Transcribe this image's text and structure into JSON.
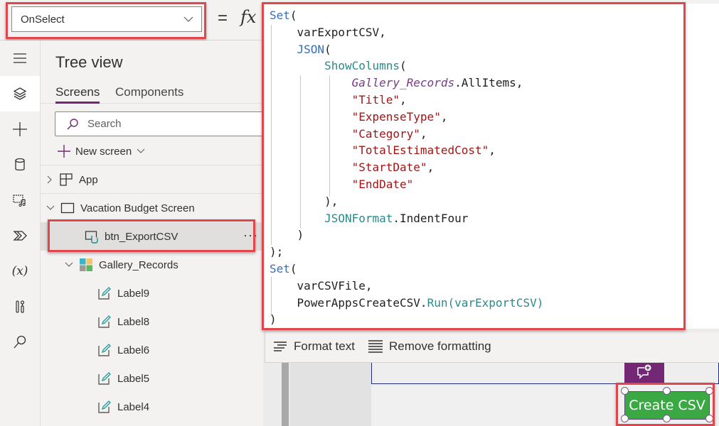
{
  "formula_bar": {
    "property": "OnSelect",
    "equals": "=",
    "fx": "fx"
  },
  "left_rail": {
    "items": [
      {
        "icon": "hamburger-menu-icon",
        "active": false
      },
      {
        "icon": "layers-tree-view-icon",
        "active": true
      },
      {
        "icon": "plus-insert-icon",
        "active": false
      },
      {
        "icon": "database-icon",
        "active": false
      },
      {
        "icon": "media-icon",
        "active": false
      },
      {
        "icon": "power-automate-icon",
        "active": false
      },
      {
        "icon": "variables-icon",
        "active": false
      },
      {
        "icon": "advanced-tools-icon",
        "active": false
      },
      {
        "icon": "search-icon",
        "active": false
      }
    ],
    "variables_label": "(x)"
  },
  "tree_view": {
    "title": "Tree view",
    "tabs": [
      {
        "label": "Screens",
        "active": true
      },
      {
        "label": "Components",
        "active": false
      }
    ],
    "search_placeholder": "Search",
    "new_screen_label": "New screen",
    "items": [
      {
        "label": "App",
        "type": "app",
        "expanded": false,
        "level": 0
      },
      {
        "label": "Vacation Budget Screen",
        "type": "screen",
        "expanded": true,
        "level": 0
      },
      {
        "label": "btn_ExportCSV",
        "type": "button",
        "selected": true,
        "level": 1
      },
      {
        "label": "Gallery_Records",
        "type": "gallery",
        "expanded": true,
        "level": 1
      },
      {
        "label": "Label9",
        "type": "label",
        "level": 2
      },
      {
        "label": "Label8",
        "type": "label",
        "level": 2
      },
      {
        "label": "Label6",
        "type": "label",
        "level": 2
      },
      {
        "label": "Label5",
        "type": "label",
        "level": 2
      },
      {
        "label": "Label4",
        "type": "label",
        "level": 2
      }
    ],
    "more_label": "···"
  },
  "formula_editor": {
    "lines": [
      "Set(",
      "    varExportCSV,",
      "    JSON(",
      "        ShowColumns(",
      "            Gallery_Records.AllItems,",
      "            \"Title\",",
      "            \"ExpenseType\",",
      "            \"Category\",",
      "            \"TotalEstimatedCost\",",
      "            \"StartDate\",",
      "            \"EndDate\"",
      "        ),",
      "        JSONFormat.IndentFour",
      "    )",
      ");",
      "Set(",
      "    varCSVFile,",
      "    PowerAppsCreateCSV.Run(varExportCSV)",
      ")"
    ]
  },
  "format_toolbar": {
    "format_text": "Format text",
    "remove_formatting": "Remove formatting"
  },
  "canvas": {
    "create_csv_button": "Create CSV",
    "button_color": "#3aa843",
    "comment_button_color": "#742774"
  },
  "colors": {
    "highlight_box": "#e0474c",
    "accent": "#742774"
  }
}
